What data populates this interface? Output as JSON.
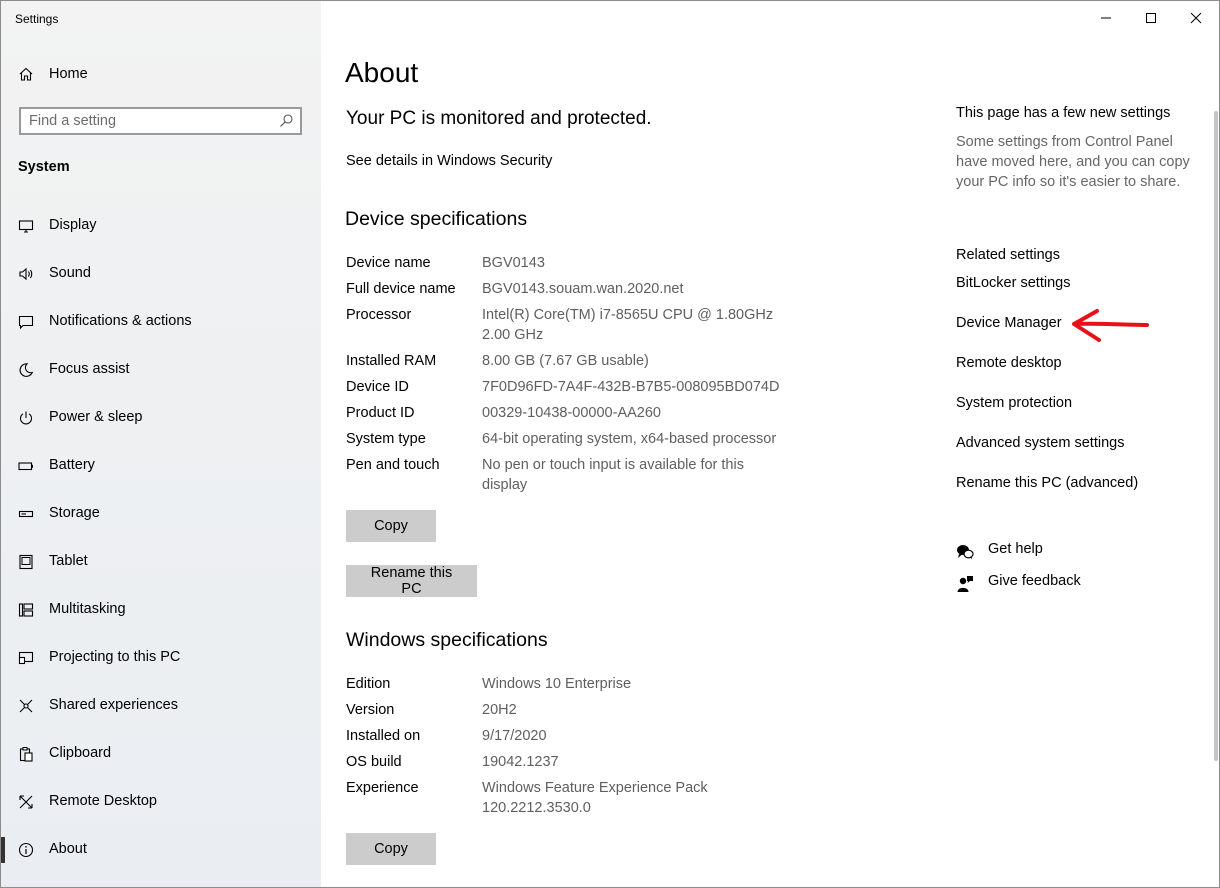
{
  "window": {
    "title": "Settings"
  },
  "sidebar": {
    "home_label": "Home",
    "search_placeholder": "Find a setting",
    "section_title": "System",
    "items": [
      {
        "label": "Display",
        "icon": "display-icon"
      },
      {
        "label": "Sound",
        "icon": "sound-icon"
      },
      {
        "label": "Notifications & actions",
        "icon": "notifications-icon"
      },
      {
        "label": "Focus assist",
        "icon": "moon-icon"
      },
      {
        "label": "Power & sleep",
        "icon": "power-icon"
      },
      {
        "label": "Battery",
        "icon": "battery-icon"
      },
      {
        "label": "Storage",
        "icon": "storage-icon"
      },
      {
        "label": "Tablet",
        "icon": "tablet-icon"
      },
      {
        "label": "Multitasking",
        "icon": "multitasking-icon"
      },
      {
        "label": "Projecting to this PC",
        "icon": "projecting-icon"
      },
      {
        "label": "Shared experiences",
        "icon": "shared-icon"
      },
      {
        "label": "Clipboard",
        "icon": "clipboard-icon"
      },
      {
        "label": "Remote Desktop",
        "icon": "remote-desktop-icon"
      },
      {
        "label": "About",
        "icon": "info-icon",
        "active": true
      }
    ]
  },
  "main": {
    "title": "About",
    "status": "Your PC is monitored and protected.",
    "security_link": "See details in Windows Security",
    "device_specs": {
      "heading": "Device specifications",
      "rows": [
        {
          "label": "Device name",
          "value": "BGV0143"
        },
        {
          "label": "Full device name",
          "value": "BGV0143.souam.wan.2020.net"
        },
        {
          "label": "Processor",
          "value": "Intel(R) Core(TM) i7-8565U CPU @ 1.80GHz 2.00 GHz"
        },
        {
          "label": "Installed RAM",
          "value": "8.00 GB (7.67 GB usable)"
        },
        {
          "label": "Device ID",
          "value": "7F0D96FD-7A4F-432B-B7B5-008095BD074D"
        },
        {
          "label": "Product ID",
          "value": "00329-10438-00000-AA260"
        },
        {
          "label": "System type",
          "value": "64-bit operating system, x64-based processor"
        },
        {
          "label": "Pen and touch",
          "value": "No pen or touch input is available for this display"
        }
      ],
      "copy_label": "Copy",
      "rename_label": "Rename this PC"
    },
    "windows_specs": {
      "heading": "Windows specifications",
      "rows": [
        {
          "label": "Edition",
          "value": "Windows 10 Enterprise"
        },
        {
          "label": "Version",
          "value": "20H2"
        },
        {
          "label": "Installed on",
          "value": "9/17/2020"
        },
        {
          "label": "OS build",
          "value": "19042.1237"
        },
        {
          "label": "Experience",
          "value": "Windows Feature Experience Pack 120.2212.3530.0"
        }
      ],
      "copy_label": "Copy"
    }
  },
  "right_pane": {
    "new_settings_heading": "This page has a few new settings",
    "new_settings_desc": "Some settings from Control Panel have moved here, and you can copy your PC info so it's easier to share.",
    "related_heading": "Related settings",
    "related_links": [
      "BitLocker settings",
      "Device Manager",
      "Remote desktop",
      "System protection",
      "Advanced system settings",
      "Rename this PC (advanced)"
    ],
    "help_label": "Get help",
    "feedback_label": "Give feedback",
    "arrow_color": "#e8101a"
  }
}
